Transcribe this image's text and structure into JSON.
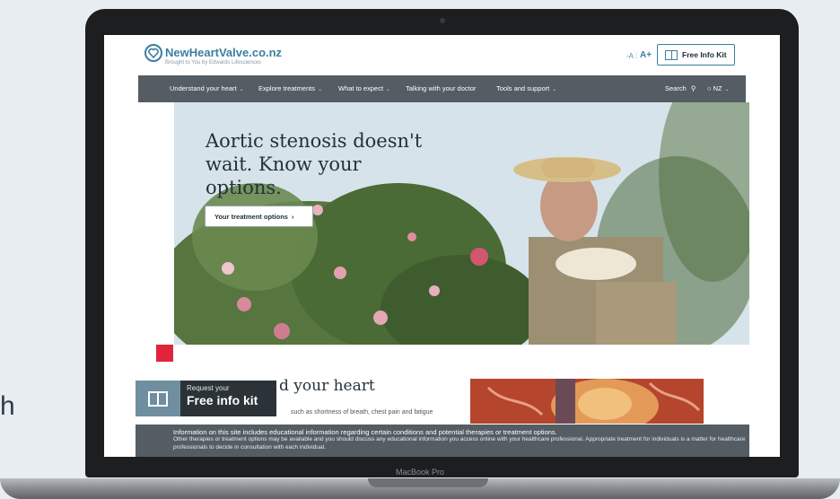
{
  "side_letter": "h",
  "device": {
    "model_label": "MacBook Pro"
  },
  "site": {
    "logo_name": "NewHeartValve.co.nz",
    "logo_tagline": "Brought to You by Edwards Lifesciences",
    "font_small": "-A",
    "font_large": "A+",
    "info_kit_button": "Free Info Kit"
  },
  "nav": {
    "items": [
      {
        "label": "Understand your heart",
        "has_dropdown": true
      },
      {
        "label": "Explore treatments",
        "has_dropdown": true
      },
      {
        "label": "What to expect",
        "has_dropdown": true
      },
      {
        "label": "Talking with your doctor",
        "has_dropdown": false
      },
      {
        "label": "Tools and support",
        "has_dropdown": true
      }
    ],
    "search_label": "Search",
    "region_label": "NZ"
  },
  "hero": {
    "title": "Aortic stenosis doesn't wait. Know your options.",
    "cta": "Your treatment options"
  },
  "section": {
    "title_visible": "d your heart",
    "text_visible": "such as shortness of breath, chest pain and fatigue"
  },
  "kit_banner": {
    "small": "Request your",
    "big": "Free info kit"
  },
  "disclaimer": {
    "line1": "Information on this site includes educational information regarding certain conditions and potential therapies or treatment options.",
    "line2": "Other therapies or treatment options may be available and you should discuss any educational information you access online with your healthcare professional. Appropriate treatment for individuals is a matter for healthcare professionals to decide in consultation with each individual."
  },
  "colors": {
    "brand": "#3c7ea0",
    "nav": "#545d63",
    "accent_red": "#e2233c"
  }
}
